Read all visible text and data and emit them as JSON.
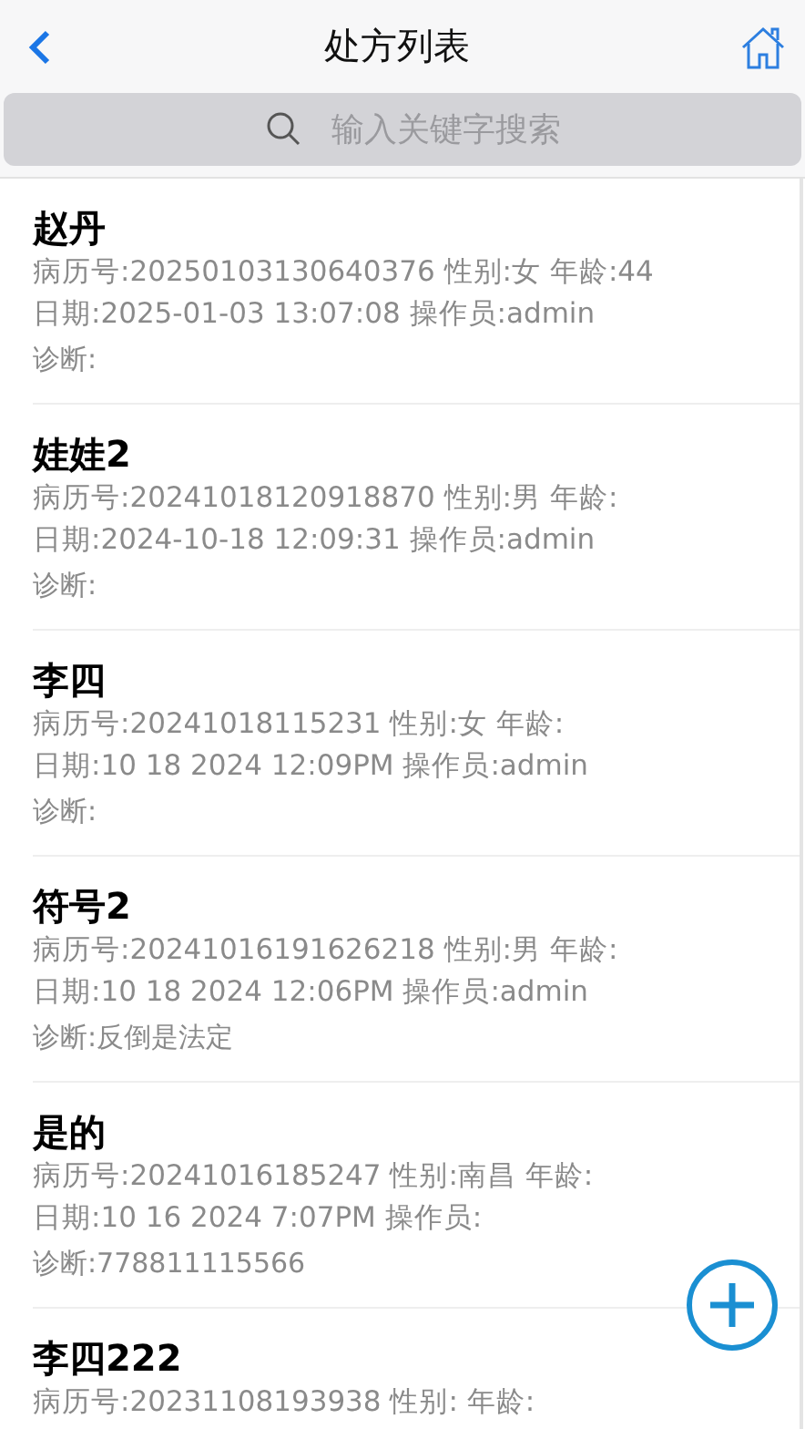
{
  "header": {
    "title": "处方列表"
  },
  "search": {
    "placeholder": "输入关键字搜索"
  },
  "records": [
    {
      "name": "赵丹",
      "record": "病历号:20250103130640376 性别:女 年龄:44",
      "date": "日期:2025-01-03 13:07:08 操作员:admin",
      "diagnosis": "诊断:"
    },
    {
      "name": "娃娃2",
      "record": "病历号:20241018120918870 性别:男 年龄:",
      "date": "日期:2024-10-18 12:09:31 操作员:admin",
      "diagnosis": "诊断:"
    },
    {
      "name": "李四",
      "record": "病历号:20241018115231 性别:女 年龄:",
      "date": "日期:10 18 2024 12:09PM 操作员:admin",
      "diagnosis": "诊断:"
    },
    {
      "name": "符号2",
      "record": "病历号:20241016191626218 性别:男 年龄:",
      "date": "日期:10 18 2024 12:06PM 操作员:admin",
      "diagnosis": "诊断:反倒是法定"
    },
    {
      "name": "是的",
      "record": "病历号:20241016185247 性别:南昌 年龄:",
      "date": "日期:10 16 2024 7:07PM 操作员:",
      "diagnosis": "诊断:778811115566"
    },
    {
      "name": "李四222",
      "record": "病历号:20231108193938 性别: 年龄:"
    }
  ]
}
